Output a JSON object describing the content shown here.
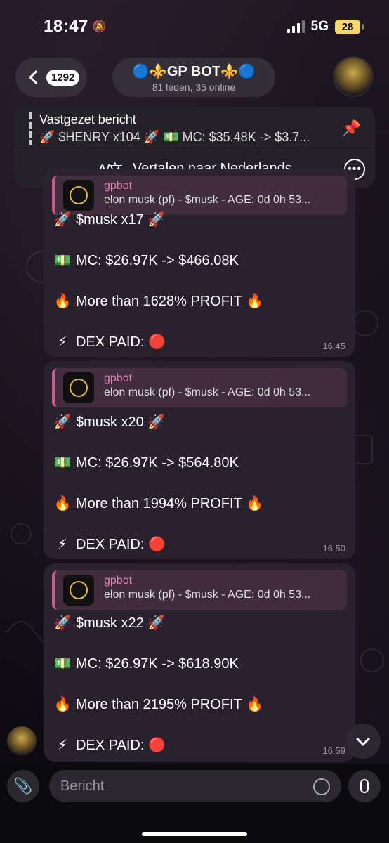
{
  "status": {
    "time": "18:47",
    "network": "5G",
    "battery": "28"
  },
  "header": {
    "back_count": "1292",
    "title": "🔵⚜️GP BOT⚜️🔵",
    "subtitle": "81 leden, 35 online"
  },
  "pinned": {
    "label": "Vastgezet bericht",
    "text": "🚀 $HENRY x104 🚀 💵 MC: $35.48K -> $3.7..."
  },
  "translate": {
    "label": "Vertalen naar Nederlands"
  },
  "messages": [
    {
      "reply_name": "gpbot",
      "reply_text": "elon musk (pf) - $musk - AGE: 0d 0h 53...",
      "title": "$musk x17",
      "mc": "MC: $26.97K -> $466.08K",
      "profit": "More than 1628% PROFIT",
      "dex": "DEX PAID:",
      "time": "16:45"
    },
    {
      "reply_name": "gpbot",
      "reply_text": "elon musk (pf) - $musk - AGE: 0d 0h 53...",
      "title": "$musk x20",
      "mc": "MC: $26.97K -> $564.80K",
      "profit": "More than 1994% PROFIT",
      "dex": "DEX PAID:",
      "time": "16:50"
    },
    {
      "reply_name": "gpbot",
      "reply_text": "elon musk (pf) - $musk - AGE: 0d 0h 53...",
      "title": "$musk x22",
      "mc": "MC: $26.97K -> $618.90K",
      "profit": "More than 2195% PROFIT",
      "dex": "DEX PAID:",
      "time": "16:59"
    }
  ],
  "input": {
    "placeholder": "Bericht"
  },
  "icons": {
    "rocket": "🚀",
    "money": "💵",
    "fire": "🔥",
    "bolt": "⚡",
    "red": "🔴"
  },
  "colors": {
    "accent_pink": "#e07fb2",
    "bubble": "#2a222e"
  }
}
